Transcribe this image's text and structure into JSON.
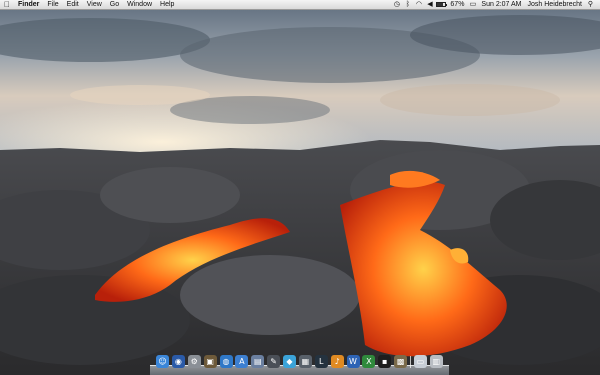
{
  "menubar": {
    "apple_icon": "apple-icon",
    "app_name": "Finder",
    "menus": [
      "File",
      "Edit",
      "View",
      "Go",
      "Window",
      "Help"
    ],
    "status": {
      "battery_percent": "67%",
      "battery_level": 0.67,
      "clock": "Sun 2:07 AM",
      "user": "Josh Heidebrecht"
    }
  },
  "wallpaper": {
    "description_icon": "lava-landscape",
    "sky_color": "#7a8592",
    "rock_color": "#3a3a3c",
    "lava_color": "#ff5a14"
  },
  "dock": {
    "items": [
      {
        "icon": "finder-icon",
        "color": "#3b86d8",
        "glyph": "☺"
      },
      {
        "icon": "dashboard-icon",
        "color": "#2a5aa8",
        "glyph": "◉"
      },
      {
        "icon": "system-preferences-icon",
        "color": "#8a8f96",
        "glyph": "⚙"
      },
      {
        "icon": "photo-browser-icon",
        "color": "#6e5a3a",
        "glyph": "▣"
      },
      {
        "icon": "globe-browser-icon",
        "color": "#2f78c8",
        "glyph": "◍"
      },
      {
        "icon": "app-store-icon",
        "color": "#3d7fd0",
        "glyph": "A"
      },
      {
        "icon": "preview-icon",
        "color": "#6a7fa0",
        "glyph": "▤"
      },
      {
        "icon": "pen-tool-icon",
        "color": "#4a4f57",
        "glyph": "✎"
      },
      {
        "icon": "water-drop-icon",
        "color": "#3ba3d8",
        "glyph": "◆"
      },
      {
        "icon": "grid-app-icon",
        "color": "#58606a",
        "glyph": "▦"
      },
      {
        "icon": "lightroom-icon",
        "color": "#24323f",
        "glyph": "L"
      },
      {
        "icon": "paint-brush-icon",
        "color": "#e08a22",
        "glyph": "♪"
      },
      {
        "icon": "word-icon",
        "color": "#2d63b5",
        "glyph": "W"
      },
      {
        "icon": "excel-icon",
        "color": "#2f8a3c",
        "glyph": "X"
      },
      {
        "icon": "terminal-icon",
        "color": "#1e1e1e",
        "glyph": "▪"
      },
      {
        "icon": "archive-utility-icon",
        "color": "#7a6a4a",
        "glyph": "▩"
      },
      {
        "icon": "downloads-stack-icon",
        "color": "#c8ced6",
        "glyph": "▭"
      },
      {
        "icon": "trash-icon",
        "color": "#b8bcc2",
        "glyph": "▥"
      }
    ]
  }
}
